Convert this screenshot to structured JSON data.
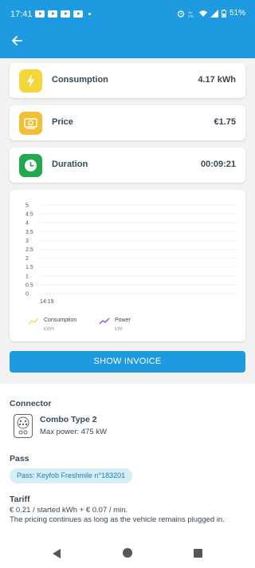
{
  "status_bar": {
    "time": "17:41",
    "battery": "51%"
  },
  "metrics": [
    {
      "label": "Consumption",
      "value": "4.17 kWh",
      "color": "#f3d63a"
    },
    {
      "label": "Price",
      "value": "€1.75",
      "color": "#f2c034"
    },
    {
      "label": "Duration",
      "value": "00:09:21",
      "color": "#22a84f"
    }
  ],
  "chart_data": {
    "type": "line",
    "x": [
      "14:19"
    ],
    "y_ticks": [
      "5",
      "4.5",
      "4",
      "3.5",
      "3",
      "2.5",
      "2",
      "1.5",
      "1",
      "0.5",
      "0"
    ],
    "ylim": [
      0,
      5
    ],
    "series": [
      {
        "name": "Consumption",
        "unit": "kWh",
        "color": "#f0e34a",
        "values": []
      },
      {
        "name": "Power",
        "unit": "kW",
        "color": "#8a4cd8",
        "values": []
      }
    ]
  },
  "actions": {
    "show_invoice": "SHOW INVOICE"
  },
  "connector": {
    "section_title": "Connector",
    "name": "Combo Type 2",
    "max_power": "Max power: 475 kW"
  },
  "pass": {
    "section_title": "Pass",
    "chip": "Pass: Keyfob Freshmile n°183201"
  },
  "tariff": {
    "section_title": "Tariff",
    "line1": "€ 0.21 / started kWh + € 0.07 / min.",
    "line2": "The pricing continues as long as the vehicle remains plugged in."
  }
}
